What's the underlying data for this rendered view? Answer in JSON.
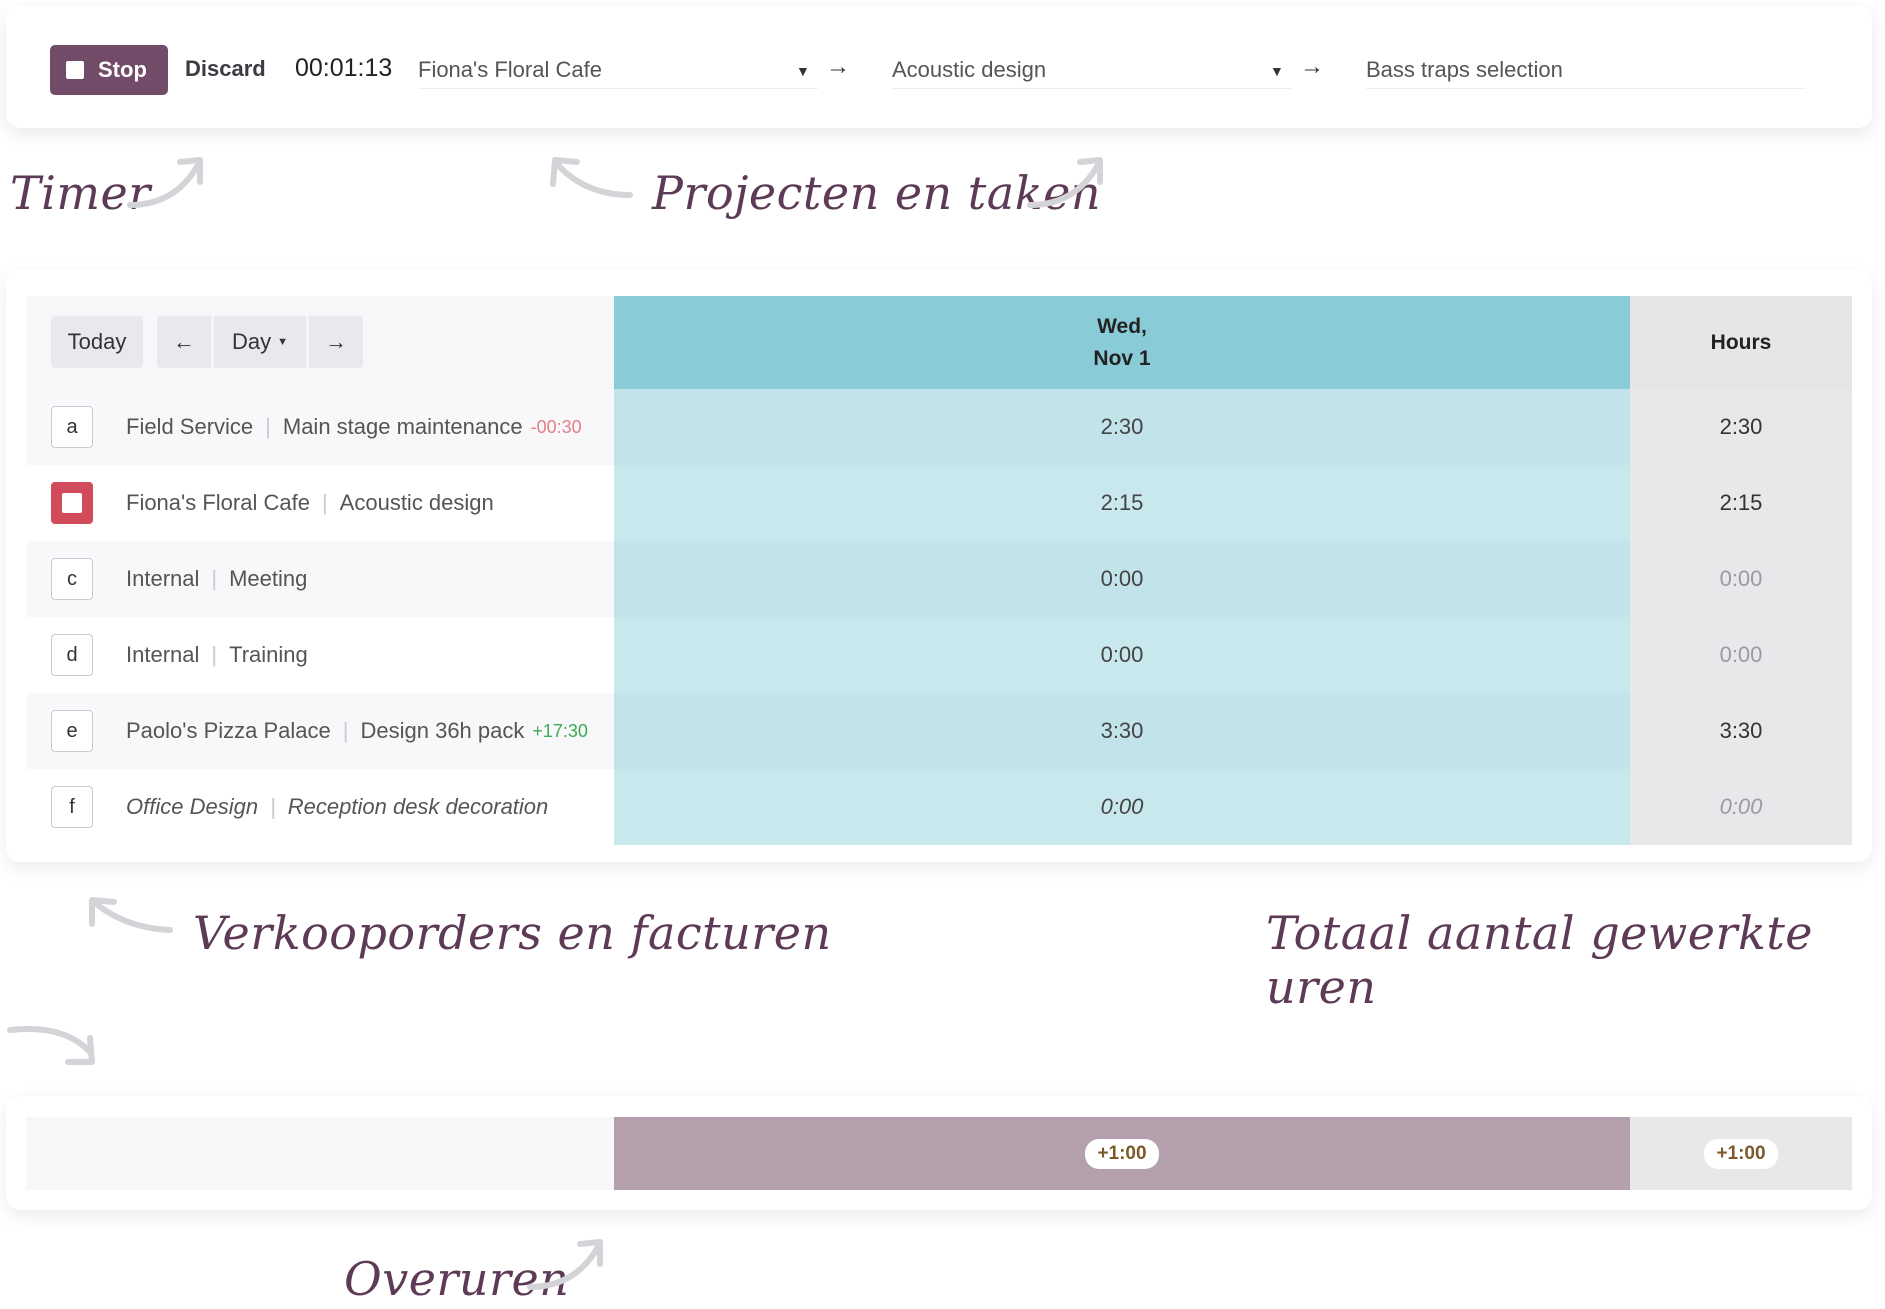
{
  "timer": {
    "stop_label": "Stop",
    "discard_label": "Discard",
    "elapsed": "00:01:13",
    "project": "Fiona's Floral Cafe",
    "task": "Acoustic design",
    "description": "Bass traps selection"
  },
  "annotations": {
    "timer": "Timer",
    "projects_tasks": "Projecten en taken",
    "sales_invoices": "Verkooporders en facturen",
    "total_hours": "Totaal aantal gewerkte uren",
    "overtime": "Overuren"
  },
  "grid": {
    "today_label": "Today",
    "scale_label": "Day",
    "day_header_line1": "Wed,",
    "day_header_line2": "Nov 1",
    "hours_header": "Hours",
    "rows": [
      {
        "key": "a",
        "project": "Field Service",
        "task": "Main stage maintenance",
        "remaining": "-00:30",
        "day": "2:30",
        "total": "2:30"
      },
      {
        "key": "",
        "project": "Fiona's Floral Cafe",
        "task": "Acoustic design",
        "remaining": "",
        "day": "2:15",
        "total": "2:15"
      },
      {
        "key": "c",
        "project": "Internal",
        "task": "Meeting",
        "remaining": "",
        "day": "0:00",
        "total": "0:00"
      },
      {
        "key": "d",
        "project": "Internal",
        "task": "Training",
        "remaining": "",
        "day": "0:00",
        "total": "0:00"
      },
      {
        "key": "e",
        "project": "Paolo's Pizza Palace",
        "task": "Design 36h pack",
        "remaining": "+17:30",
        "day": "3:30",
        "total": "3:30"
      },
      {
        "key": "f",
        "project": "Office Design",
        "task": "Reception desk decoration",
        "remaining": "",
        "day": "0:00",
        "total": "0:00"
      }
    ]
  },
  "overtime": {
    "day": "+1:00",
    "total": "+1:00"
  }
}
